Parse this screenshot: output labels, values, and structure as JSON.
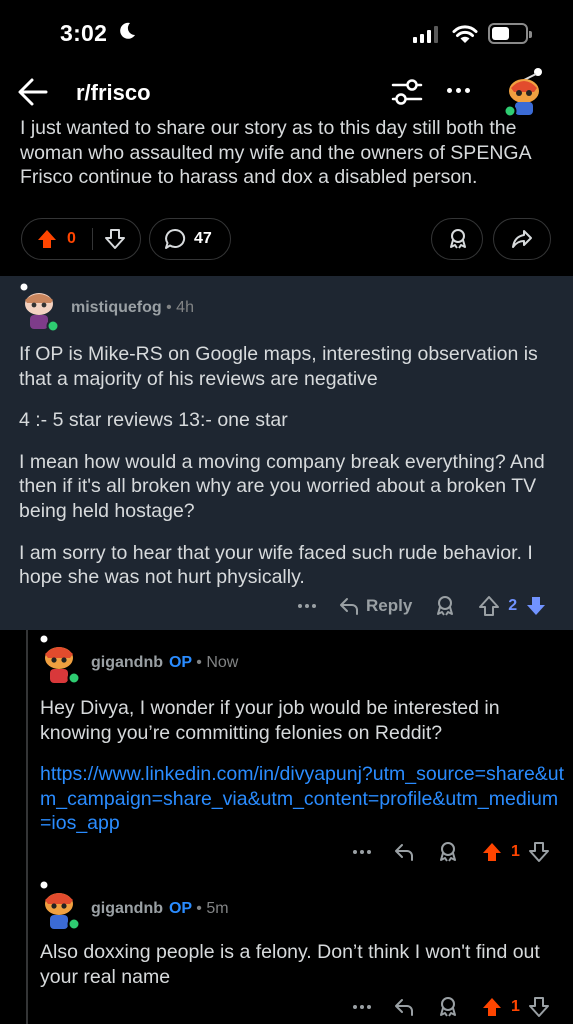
{
  "status_bar": {
    "time": "3:02"
  },
  "nav": {
    "subreddit": "r/frisco"
  },
  "post": {
    "body": "I just wanted to share our story as to this day still both the woman who assaulted my wife and the owners of SPENGA Frisco continue to harass and dox a disabled person.",
    "vote_count": "0",
    "comment_count": "47"
  },
  "comments": [
    {
      "username": "mistiquefog",
      "time": "• 4h",
      "paragraphs": [
        "If OP is Mike-RS on Google maps, interesting observation is that a majority of his reviews are negative",
        "4 :- 5 star reviews 13:- one star",
        "I mean how would a moving company break everything? And then if it's all broken why are you worried about a broken TV being held hostage?",
        "I am sorry to hear that your wife faced such rude behavior. I hope she was not hurt physically."
      ],
      "reply_label": "Reply",
      "score": "2"
    },
    {
      "username": "gigandnb",
      "op_badge": "OP",
      "time": "• Now",
      "text": "Hey Divya, I wonder if your job would be interested in knowing you’re committing felonies on Reddit?",
      "link": "https://www.linkedin.com/in/divyapunj?utm_source=share&utm_campaign=share_via&utm_content=profile&utm_medium=ios_app",
      "score": "1"
    },
    {
      "username": "gigandnb",
      "op_badge": "OP",
      "time": "• 5m",
      "text": "Also doxxing people is a felony. Don’t think I won't find out your real name",
      "score": "1"
    }
  ],
  "colors": {
    "background": "#000000",
    "highlight_bg": "#1e2631",
    "upvote_orange": "#ff4500",
    "downvote_blue": "#7193ff",
    "link_blue": "#2a8cff",
    "online_green": "#2ecc71"
  },
  "icons": [
    "moon-icon",
    "signal-icon",
    "wifi-icon",
    "battery-icon",
    "back-arrow-icon",
    "filter-icon",
    "more-icon",
    "avatar",
    "upvote-icon",
    "downvote-icon",
    "comment-icon",
    "award-icon",
    "share-icon",
    "reply-icon"
  ]
}
